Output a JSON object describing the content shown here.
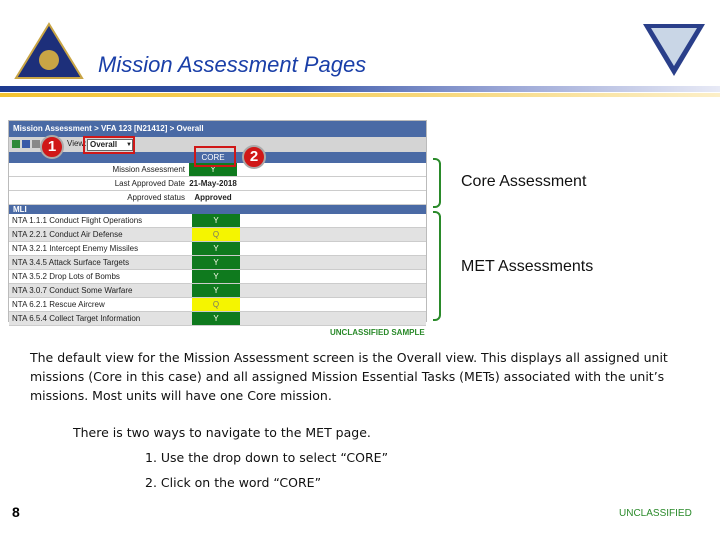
{
  "title": "Mission Assessment Pages",
  "screen": {
    "breadcrumb": "Mission Assessment > VFA 123 [N21412] > Overall",
    "view_label": "View:",
    "view_value": "Overall",
    "core_header": "CORE",
    "summary": [
      {
        "label": "Mission Assessment",
        "value": "Y",
        "status": "green"
      },
      {
        "label": "Last Approved Date",
        "value": "21-May-2018",
        "status": "none"
      },
      {
        "label": "Approved status",
        "value": "Approved",
        "status": "none"
      }
    ],
    "section": "MLI",
    "tasks": [
      {
        "label": "NTA 1.1.1 Conduct Flight Operations",
        "value": "Y",
        "status": "green"
      },
      {
        "label": "NTA 2.2.1 Conduct Air Defense",
        "value": "Q",
        "status": "yellow"
      },
      {
        "label": "NTA 3.2.1 Intercept Enemy Missiles",
        "value": "Y",
        "status": "green"
      },
      {
        "label": "NTA 3.4.5 Attack Surface Targets",
        "value": "Y",
        "status": "green"
      },
      {
        "label": "NTA 3.5.2 Drop Lots of Bombs",
        "value": "Y",
        "status": "green"
      },
      {
        "label": "NTA 3.0.7 Conduct Some Warfare",
        "value": "Y",
        "status": "green"
      },
      {
        "label": "NTA 6.2.1 Rescue Aircrew",
        "value": "Q",
        "status": "yellow"
      },
      {
        "label": "NTA 6.5.4 Collect Target Information",
        "value": "Y",
        "status": "green"
      }
    ],
    "sample_label": "UNCLASSIFIED SAMPLE"
  },
  "callouts": {
    "one": "1",
    "two": "2"
  },
  "side_labels": {
    "core": "Core Assessment",
    "met": "MET Assessments"
  },
  "body": {
    "paragraph": "The default view for the Mission Assessment screen is the Overall view. This displays all assigned unit missions (Core in this case) and all assigned Mission Essential Tasks (METs) associated with the unit’s missions. Most units will have one Core mission.",
    "intro": "There is two ways to navigate to the MET page.",
    "step1": "1. Use the drop down to select “CORE”",
    "step2": "2. Click on the word “CORE”"
  },
  "footer": {
    "page": "8",
    "classification": "UNCLASSIFIED"
  }
}
